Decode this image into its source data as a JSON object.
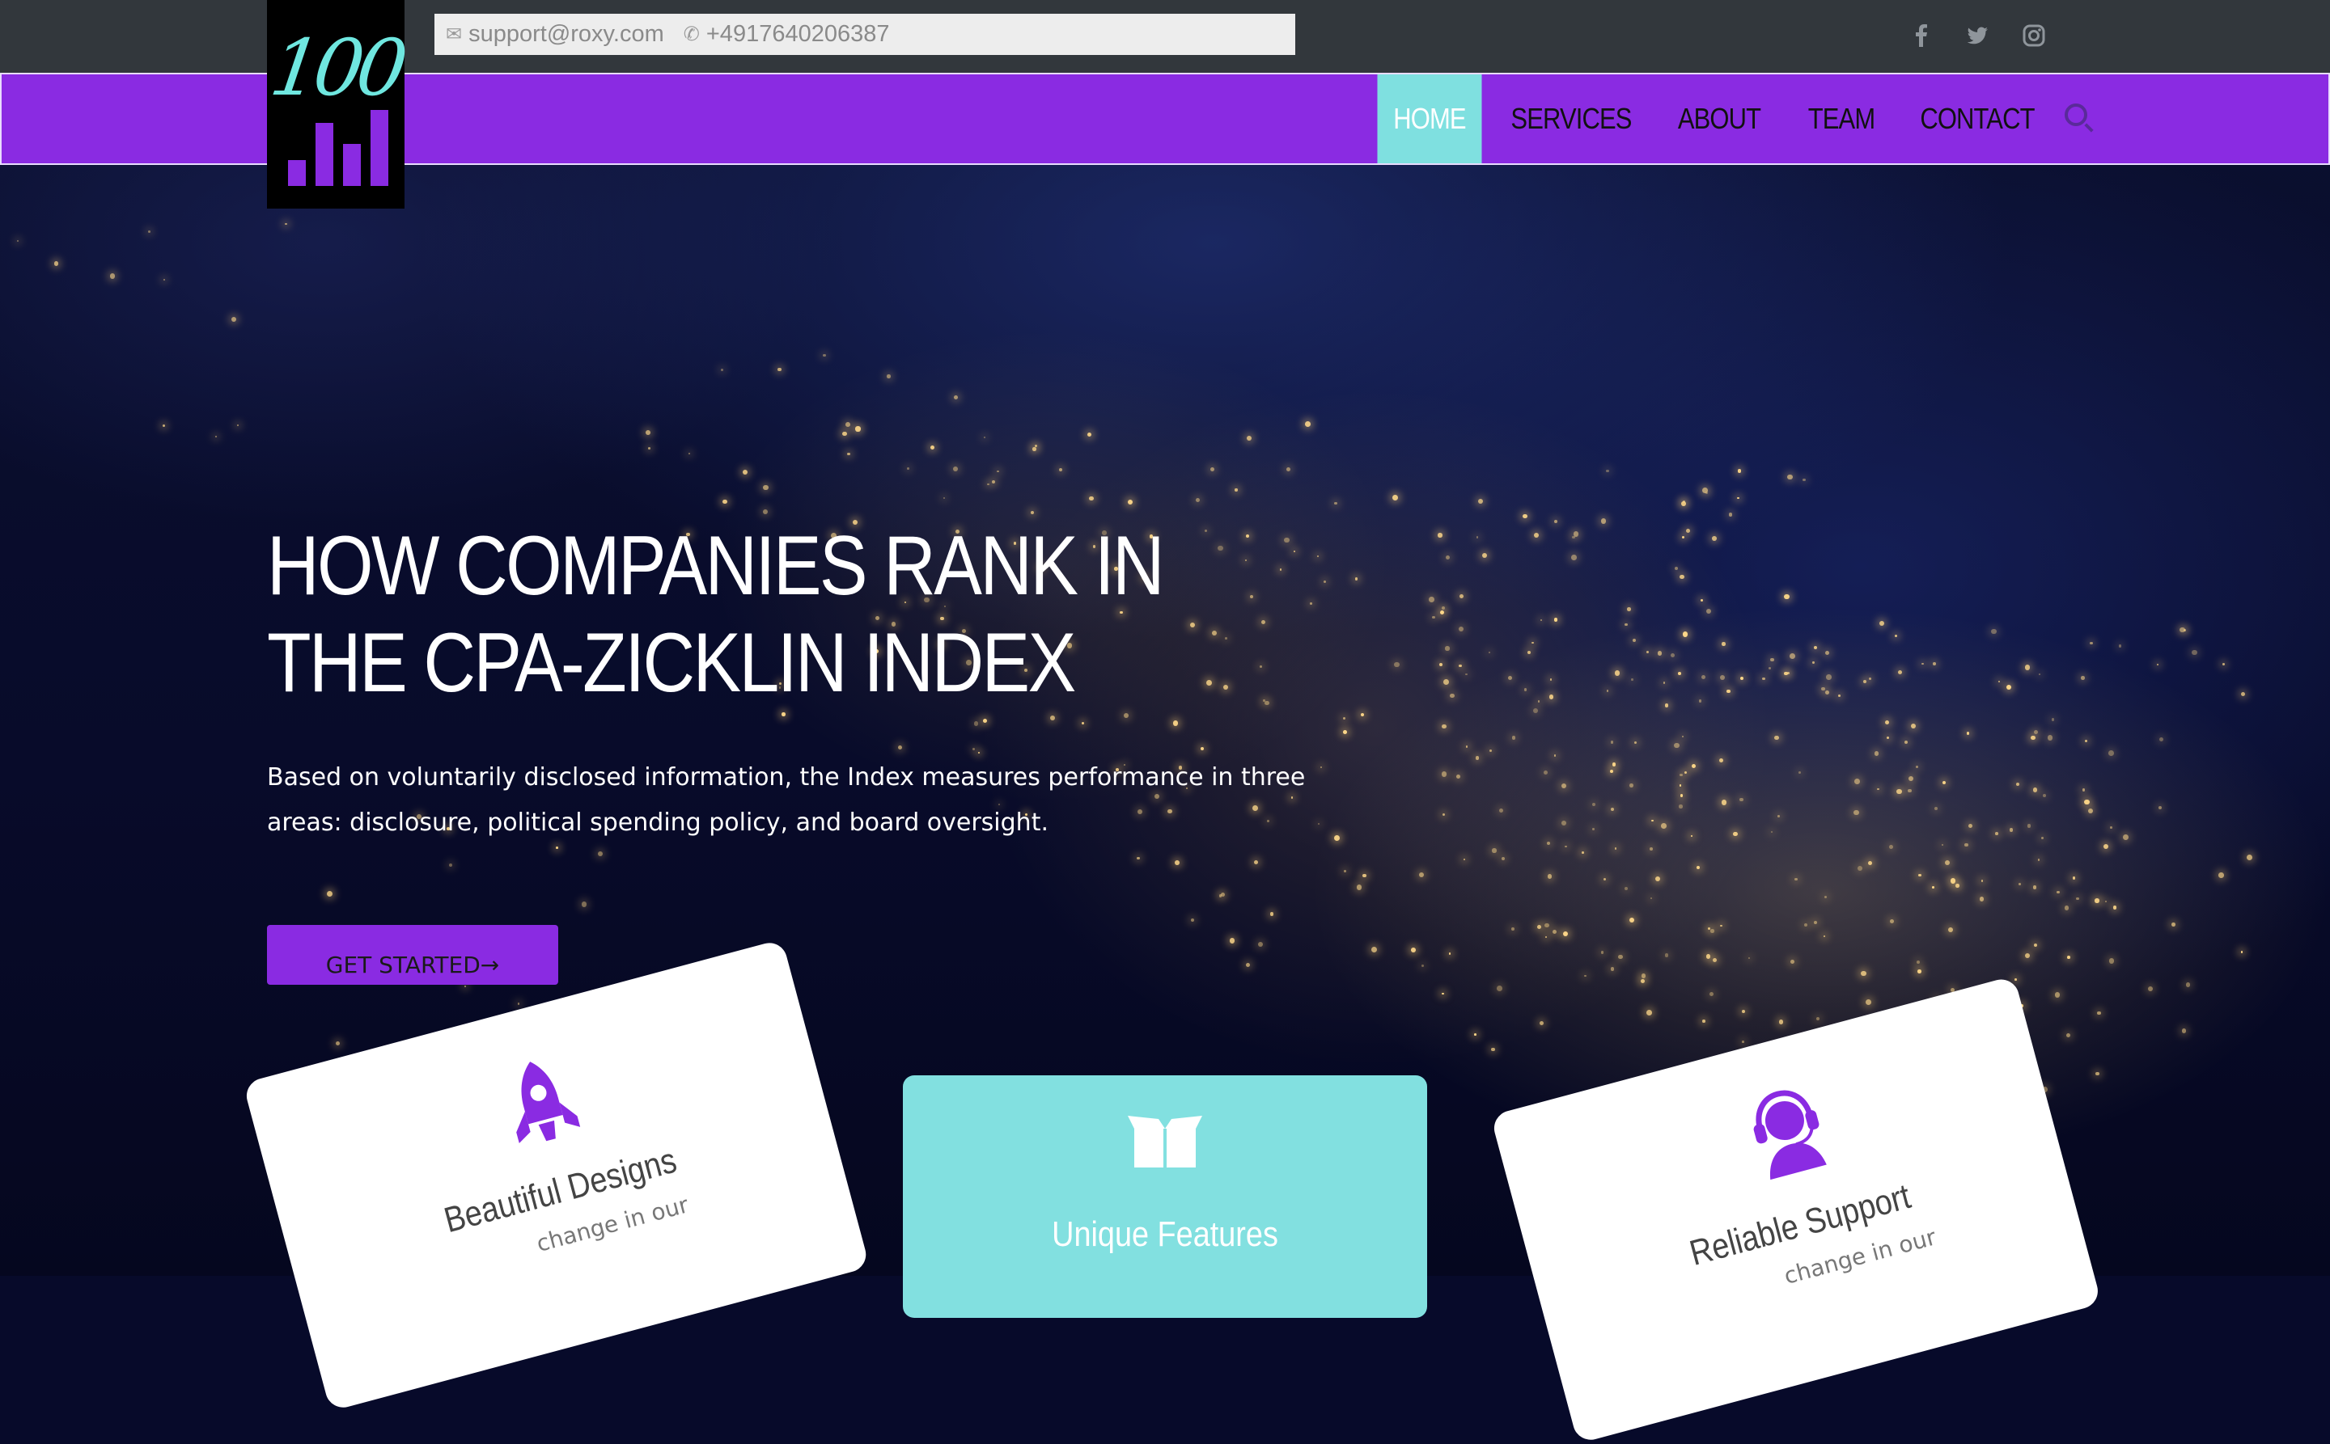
{
  "topbar": {
    "email": "support@roxy.com",
    "phone": "+4917640206387",
    "social_icons": [
      "facebook-icon",
      "twitter-icon",
      "instagram-icon"
    ]
  },
  "logo": {
    "text": "100"
  },
  "nav": {
    "items": [
      {
        "label": "HOME",
        "active": true
      },
      {
        "label": "SERVICES",
        "active": false
      },
      {
        "label": "ABOUT",
        "active": false
      },
      {
        "label": "TEAM",
        "active": false
      },
      {
        "label": "CONTACT",
        "active": false
      }
    ]
  },
  "hero": {
    "title_line1": "HOW COMPANIES RANK IN",
    "title_line2": "THE CPA-ZICKLIN INDEX",
    "subtitle": "Based on voluntarily disclosed information, the Index measures performance in three areas: disclosure, political spending policy, and board oversight.",
    "cta_label": "GET STARTED→"
  },
  "features": [
    {
      "title": "Beautiful Designs",
      "text": "change in our",
      "icon": "rocket-icon"
    },
    {
      "title": "Unique Features",
      "text": "",
      "icon": "open-box-icon"
    },
    {
      "title": "Reliable Support",
      "text": "change in our",
      "icon": "headset-support-icon"
    }
  ],
  "colors": {
    "accent": "#8a2be2",
    "teal": "#7fe0e0",
    "topbar": "#32373c"
  }
}
